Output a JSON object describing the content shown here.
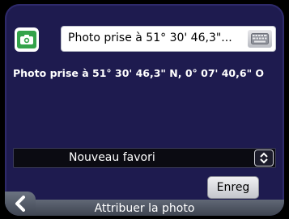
{
  "name_field": {
    "value": "Photo prise à 51° 30' 46,3\"..."
  },
  "info": {
    "text": "Photo prise à 51° 30' 46,3\" N, 0° 07' 40,6\" O"
  },
  "category_select": {
    "selected": "Nouveau favori"
  },
  "buttons": {
    "save_label": "Enreg"
  },
  "footer": {
    "title": "Attribuer la photo"
  },
  "icons": {
    "photo": "camera-icon",
    "keyboard": "keyboard-icon",
    "spinner": "up-down-arrows-icon",
    "back": "chevron-left-icon"
  },
  "colors": {
    "panel_bg": "#1e1b4f",
    "photo_green": "#34a34a"
  }
}
